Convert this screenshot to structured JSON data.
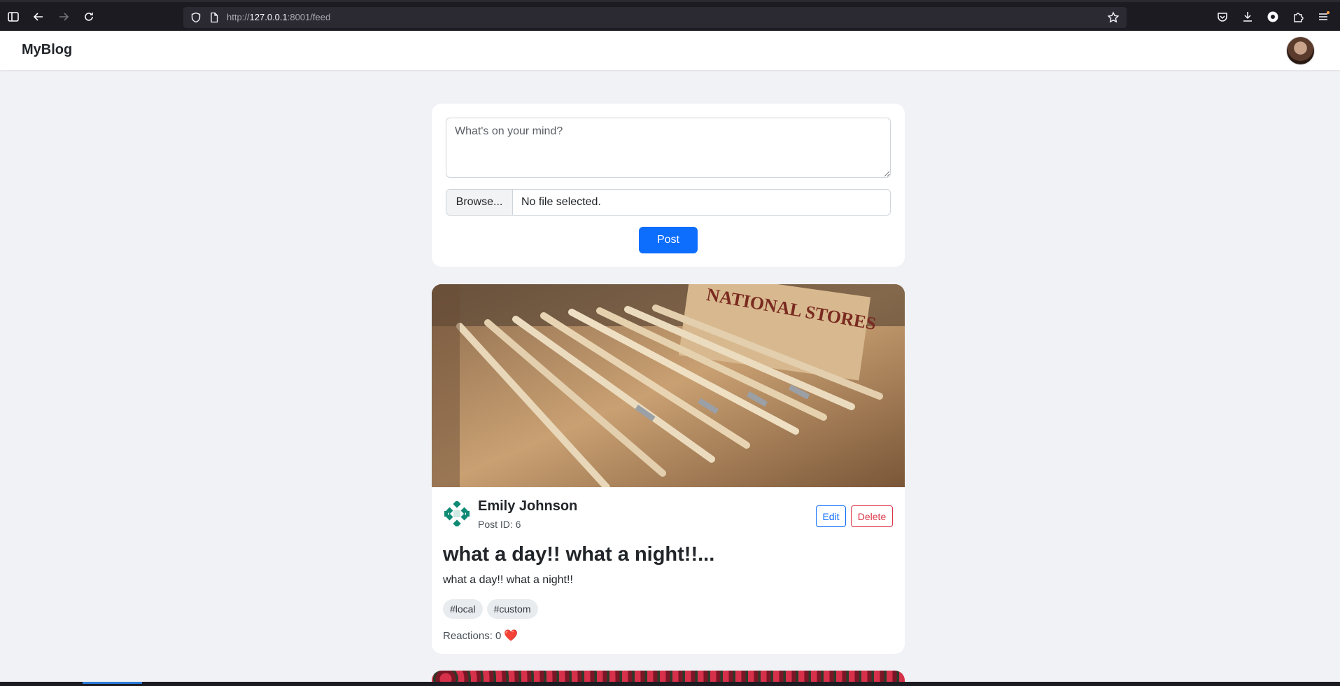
{
  "browser": {
    "url_scheme": "http://",
    "url_host": "127.0.0.1",
    "url_rest": ":8001/feed"
  },
  "navbar": {
    "brand": "MyBlog"
  },
  "composer": {
    "placeholder": "What's on your mind?",
    "browse_label": "Browse...",
    "file_status": "No file selected.",
    "post_label": "Post"
  },
  "post": {
    "author": "Emily Johnson",
    "post_id": "Post ID: 6",
    "edit_label": "Edit",
    "delete_label": "Delete",
    "title": "what a day!! what a night!!...",
    "body": "what a day!! what a night!!",
    "tags": [
      "#local",
      "#custom"
    ],
    "reactions_label": "Reactions: 0",
    "reaction_icon": "❤️"
  },
  "colors": {
    "primary": "#0d6efd",
    "danger": "#dc3545",
    "page_bg": "#f0f2f5"
  }
}
